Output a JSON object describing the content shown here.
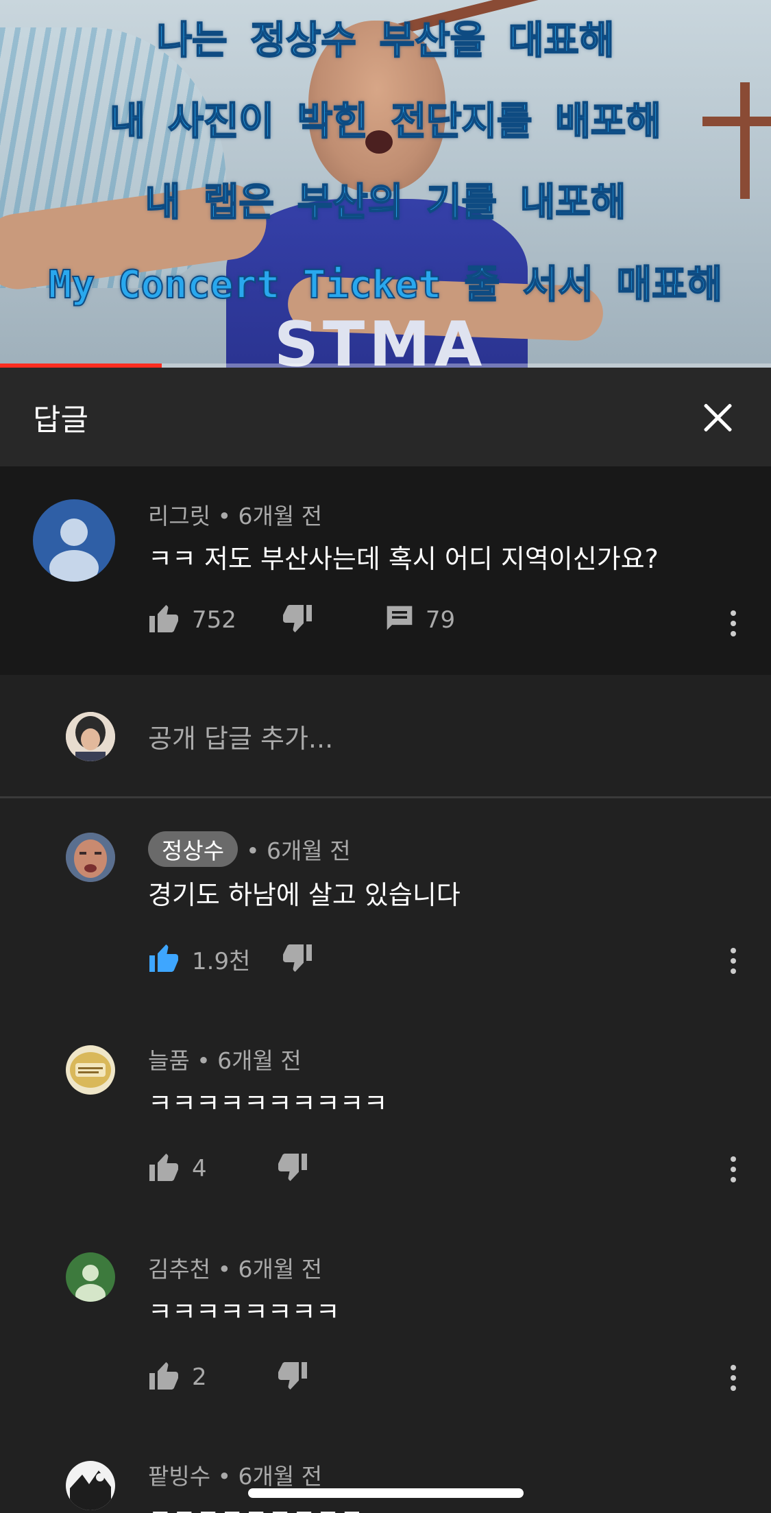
{
  "video": {
    "lyrics": [
      "나는 정상수 부산을 대표해",
      "내 사진이 박힌 전단지를 배포해",
      "내 랩은 부산의 기를 내포해",
      "My Concert Ticket 줄 서서 매표해"
    ],
    "jersey_text": "STMA",
    "progress_fraction": 0.21,
    "progress_color": "#ff2d20"
  },
  "panel": {
    "title": "답글",
    "close_icon": "close-icon"
  },
  "parent_comment": {
    "author": "리그릿",
    "time": "6개월 전",
    "meta": "리그릿 • 6개월 전",
    "text": "ㅋㅋ 저도 부산사는데 혹시 어디 지역이신가요?",
    "likes": "752",
    "replies": "79",
    "avatar_color": "#2f5fa6"
  },
  "add_reply": {
    "placeholder": "공개 답글 추가..."
  },
  "replies": [
    {
      "author": "정상수",
      "is_creator": true,
      "time": "• 6개월 전",
      "text": "경기도 하남에 살고 있습니다",
      "likes": "1.9천",
      "liked": true
    },
    {
      "author": "늘품",
      "meta": "늘품 • 6개월 전",
      "text": "ㅋㅋㅋㅋㅋㅋㅋㅋㅋㅋ",
      "likes": "4"
    },
    {
      "author": "김추천",
      "meta": "김추천 • 6개월 전",
      "text": "ㅋㅋㅋㅋㅋㅋㅋㅋ",
      "likes": "2",
      "avatar_color": "#3d7a3d"
    },
    {
      "author": "팥빙수",
      "meta": "팥빙수 • 6개월 전",
      "text": "ㅋㅋㅋㅋㅋㅋㅋㅋㅋ"
    }
  ],
  "colors": {
    "like_active": "#3ea6ff",
    "icon_default": "#aaaaaa"
  }
}
